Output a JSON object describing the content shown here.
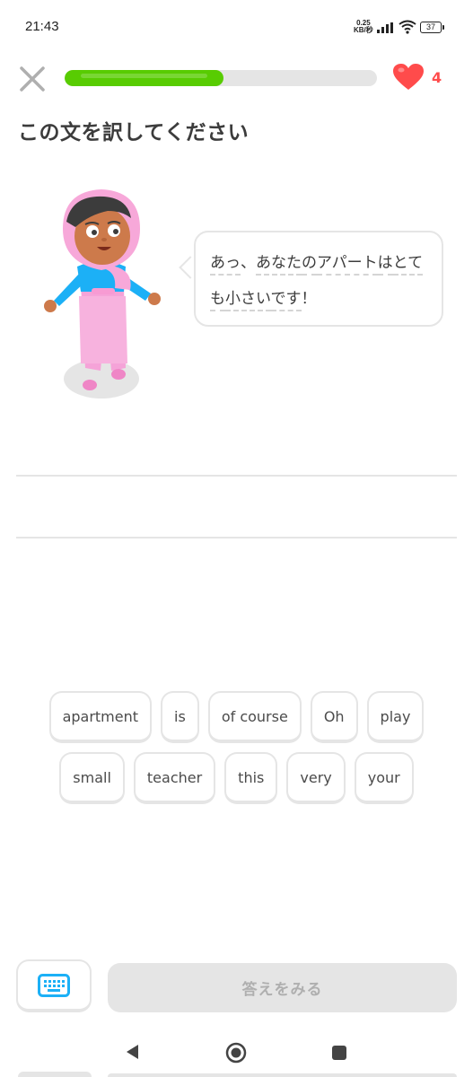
{
  "status_bar": {
    "time": "21:43",
    "net_speed_value": "0.25",
    "net_speed_unit": "KB/秒",
    "battery": "37"
  },
  "header": {
    "progress_fraction": 0.51,
    "hearts": "4"
  },
  "title": "この文を訳してください",
  "prompt": {
    "words": [
      "あっ",
      "、",
      "あなた",
      "の",
      "アパート",
      "は",
      "とても",
      "小さい",
      "です",
      "！"
    ]
  },
  "word_bank": {
    "row1": [
      "apartment",
      "is",
      "of course",
      "Oh",
      "play"
    ],
    "row2": [
      "small",
      "teacher",
      "this",
      "very",
      "your"
    ]
  },
  "bottom": {
    "check_label": "答えをみる"
  },
  "colors": {
    "progress": "#58cc02",
    "heart": "#ff4b4b",
    "keyboard_icon": "#1cb0f6",
    "character_hijab": "#f9a8d9",
    "character_shirt": "#1cb0f6"
  }
}
